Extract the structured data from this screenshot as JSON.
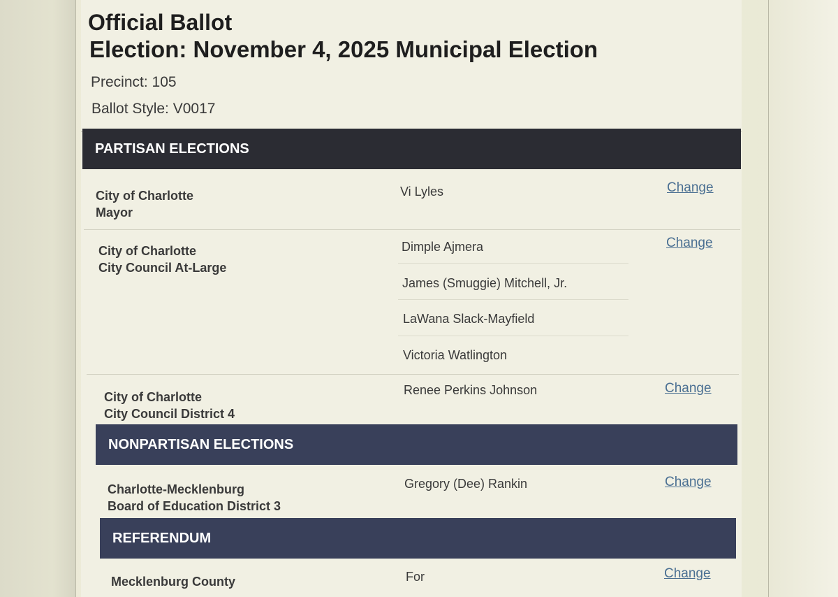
{
  "header": {
    "title": "Official Ballot",
    "election": "Election: November 4, 2025 Municipal Election",
    "precinct": "Precinct: 105",
    "ballot_style": "Ballot Style: V0017"
  },
  "sections": {
    "partisan": "PARTISAN ELECTIONS",
    "nonpartisan": "NONPARTISAN ELECTIONS",
    "referendum": "REFERENDUM"
  },
  "contests": [
    {
      "jurisdiction": "City of Charlotte",
      "office": "Mayor",
      "choices": [
        "Vi Lyles"
      ],
      "change_label": "Change"
    },
    {
      "jurisdiction": "City of Charlotte",
      "office": "City Council At-Large",
      "choices": [
        "Dimple Ajmera",
        "James (Smuggie) Mitchell, Jr.",
        "LaWana Slack-Mayfield",
        "Victoria Watlington"
      ],
      "change_label": "Change"
    },
    {
      "jurisdiction": "City of Charlotte",
      "office": "City Council District 4",
      "choices": [
        "Renee Perkins Johnson"
      ],
      "change_label": "Change"
    },
    {
      "jurisdiction": "Charlotte-Mecklenburg",
      "office": "Board of Education District 3",
      "choices": [
        "Gregory (Dee) Rankin"
      ],
      "change_label": "Change"
    },
    {
      "jurisdiction": "Mecklenburg County",
      "office": "",
      "choices": [
        "For"
      ],
      "change_label": "Change"
    }
  ],
  "colors": {
    "section_dark": "#2b2c33",
    "section_navy": "#39405a",
    "link": "#4a6f92"
  }
}
